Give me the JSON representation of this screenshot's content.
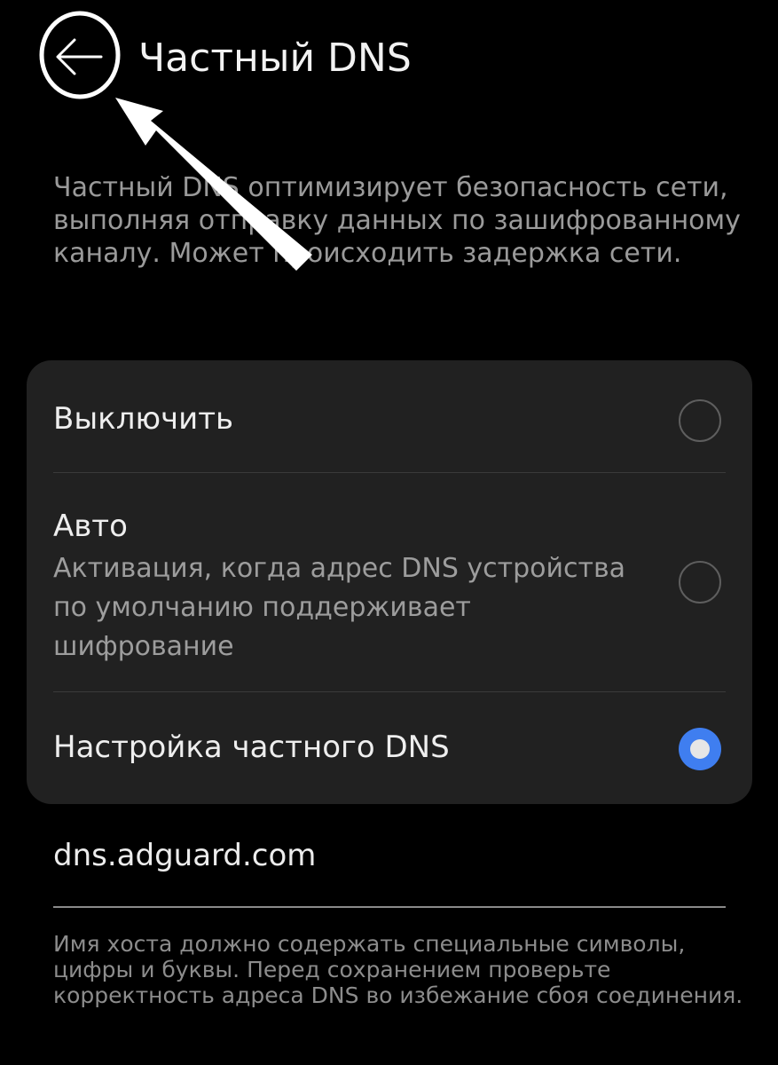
{
  "header": {
    "title": "Частный DNS",
    "back_icon": "arrow-left-icon"
  },
  "description": "Частный DNS оптимизирует безопасность сети, выполняя отправку данных по зашифрованному каналу. Может происходить задержка сети.",
  "options": [
    {
      "title": "Выключить",
      "selected": false
    },
    {
      "title": "Авто",
      "description": "Активация, когда адрес DNS устройства по умолчанию поддерживает шифрование",
      "selected": false
    },
    {
      "title": "Настройка частного DNS",
      "selected": true
    }
  ],
  "hostname": {
    "value": "dns.adguard.com",
    "hint": "Имя хоста должно содержать специальные символы, цифры и буквы. Перед сохранением проверьте корректность адреса DNS во избежание сбоя соединения."
  },
  "colors": {
    "background": "#000000",
    "card": "#212121",
    "accent": "#3f7ef0"
  }
}
